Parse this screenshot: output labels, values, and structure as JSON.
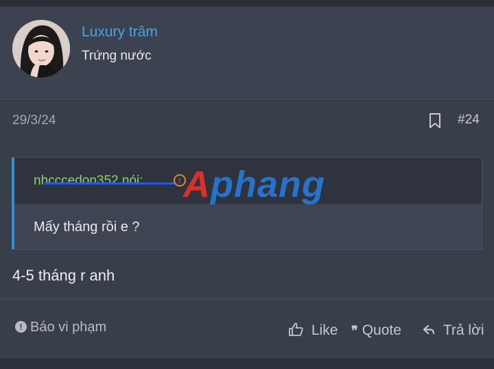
{
  "user": {
    "name": "Luxury trâm",
    "title": "Trứng nước"
  },
  "post": {
    "date": "29/3/24",
    "number": "#24",
    "message": "4-5 tháng r anh"
  },
  "quote": {
    "author": "nhcccedon352 nói:",
    "body": "Mấy tháng rồi e ?"
  },
  "watermark": {
    "initial": "A",
    "rest": "phang"
  },
  "actions": {
    "report": "Báo vi phạm",
    "like": "Like",
    "quote": "Quote",
    "reply": "Trả lời"
  },
  "colors": {
    "username": "#4aa3e8",
    "quote_border": "#2f8fd8",
    "quote_author": "#8fd36a"
  }
}
